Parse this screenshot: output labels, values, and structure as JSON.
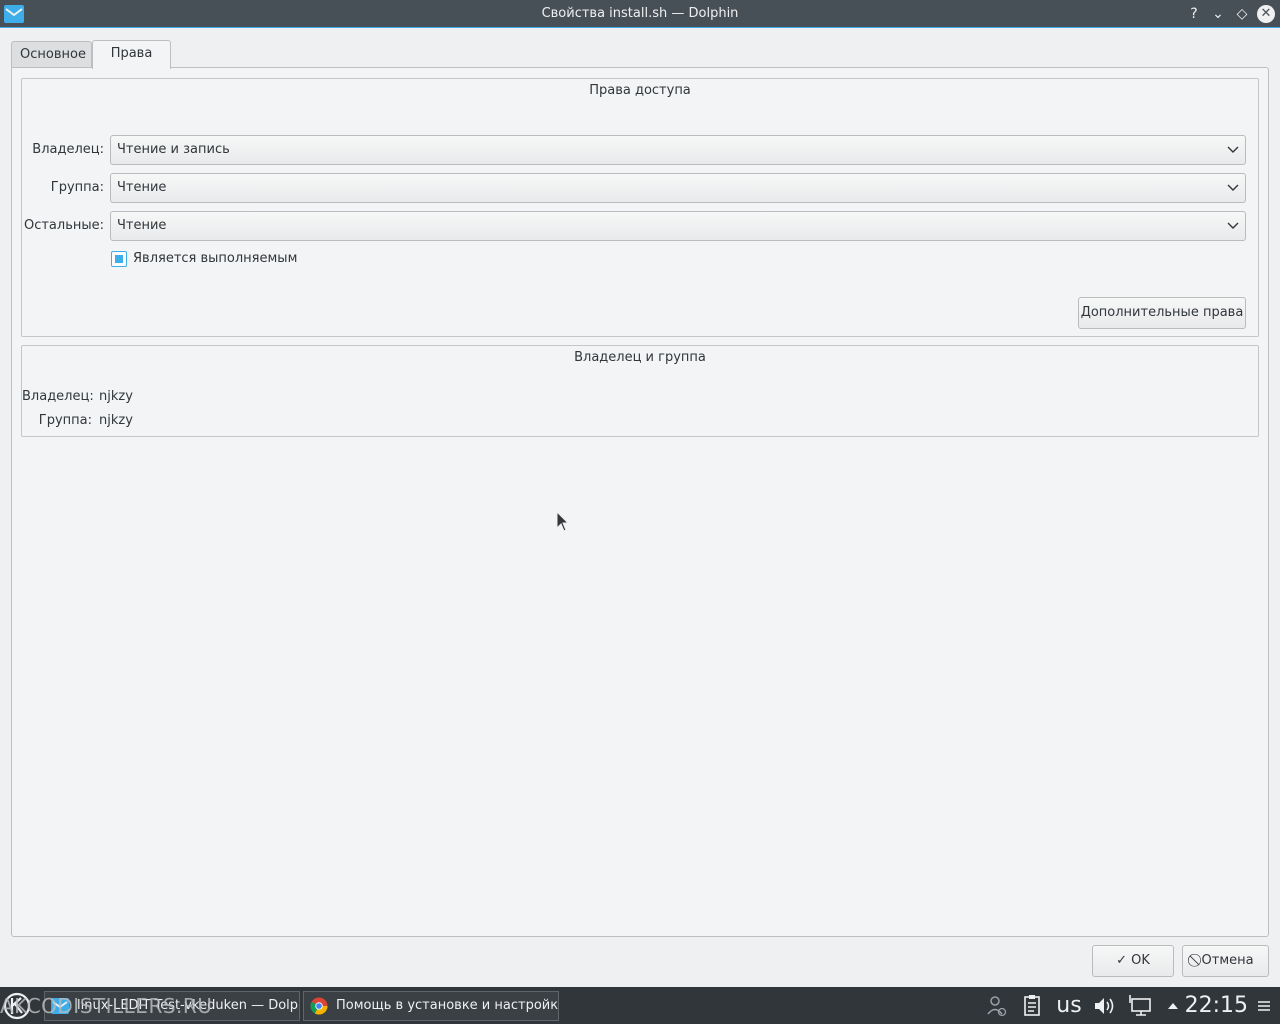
{
  "window": {
    "title": "Свойства install.sh — Dolphin",
    "buttons": {
      "help": "?",
      "minimize": "⌄",
      "maximize": "◇",
      "close": "✕"
    }
  },
  "tabs": [
    {
      "label": "Основное",
      "active": false
    },
    {
      "label": "Права",
      "active": true
    }
  ],
  "permissions": {
    "title": "Права доступа",
    "owner_label": "Владелец:",
    "owner_value": "Чтение и запись",
    "group_label": "Группа:",
    "group_value": "Чтение",
    "others_label": "Остальные:",
    "others_value": "Чтение",
    "executable_label": "Является выполняемым",
    "executable_checked": true,
    "advanced_button": "Дополнительные права"
  },
  "ownership": {
    "title": "Владелец и группа",
    "owner_label": "Владелец:",
    "owner_value": "njkzy",
    "group_label": "Группа:",
    "group_value": "njkzy"
  },
  "footer": {
    "ok_label": "OK",
    "cancel_label": "Отмена"
  },
  "taskbar": {
    "watermark": "AKCODISTILLERS.RU",
    "tasks": [
      {
        "label": "linux-LEDIT Test-vkeduken — Dolphin"
      },
      {
        "label": "Помощь в установке и настройке"
      }
    ],
    "keyboard_layout": "us",
    "clock": "22:15"
  },
  "colors": {
    "accent": "#3daee9",
    "titlebar": "#475057",
    "taskbar": "#31363b",
    "window_bg": "#eff0f1"
  }
}
